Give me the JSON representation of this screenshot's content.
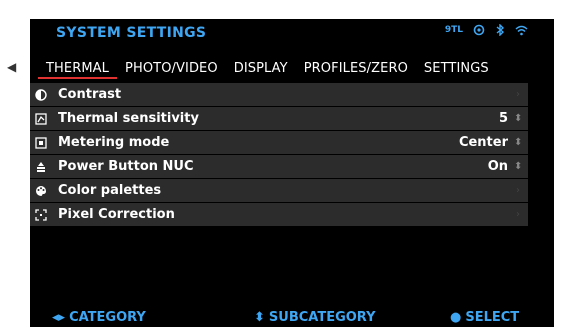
{
  "header": {
    "title": "SYSTEM SETTINGS"
  },
  "status": {
    "badge": "9TL"
  },
  "tabs": [
    {
      "label": "THERMAL"
    },
    {
      "label": "PHOTO/VIDEO"
    },
    {
      "label": "DISPLAY"
    },
    {
      "label": "PROFILES/ZERO"
    },
    {
      "label": "SETTINGS"
    }
  ],
  "rows": [
    {
      "label": "Contrast",
      "value": "",
      "icon": "contrast-icon"
    },
    {
      "label": "Thermal sensitivity",
      "value": "5",
      "icon": "sensitivity-icon"
    },
    {
      "label": "Metering mode",
      "value": "Center",
      "icon": "metering-icon"
    },
    {
      "label": "Power Button NUC",
      "value": "On",
      "icon": "power-nuc-icon"
    },
    {
      "label": "Color palettes",
      "value": "",
      "icon": "palette-icon"
    },
    {
      "label": "Pixel Correction",
      "value": "",
      "icon": "pixel-correction-icon"
    }
  ],
  "footer": {
    "category": "CATEGORY",
    "subcategory": "SUBCATEGORY",
    "select": "SELECT"
  },
  "colors": {
    "accent": "#3ea6f2",
    "active_tab": "#e13232",
    "row_bg": "#2c2c2c"
  }
}
